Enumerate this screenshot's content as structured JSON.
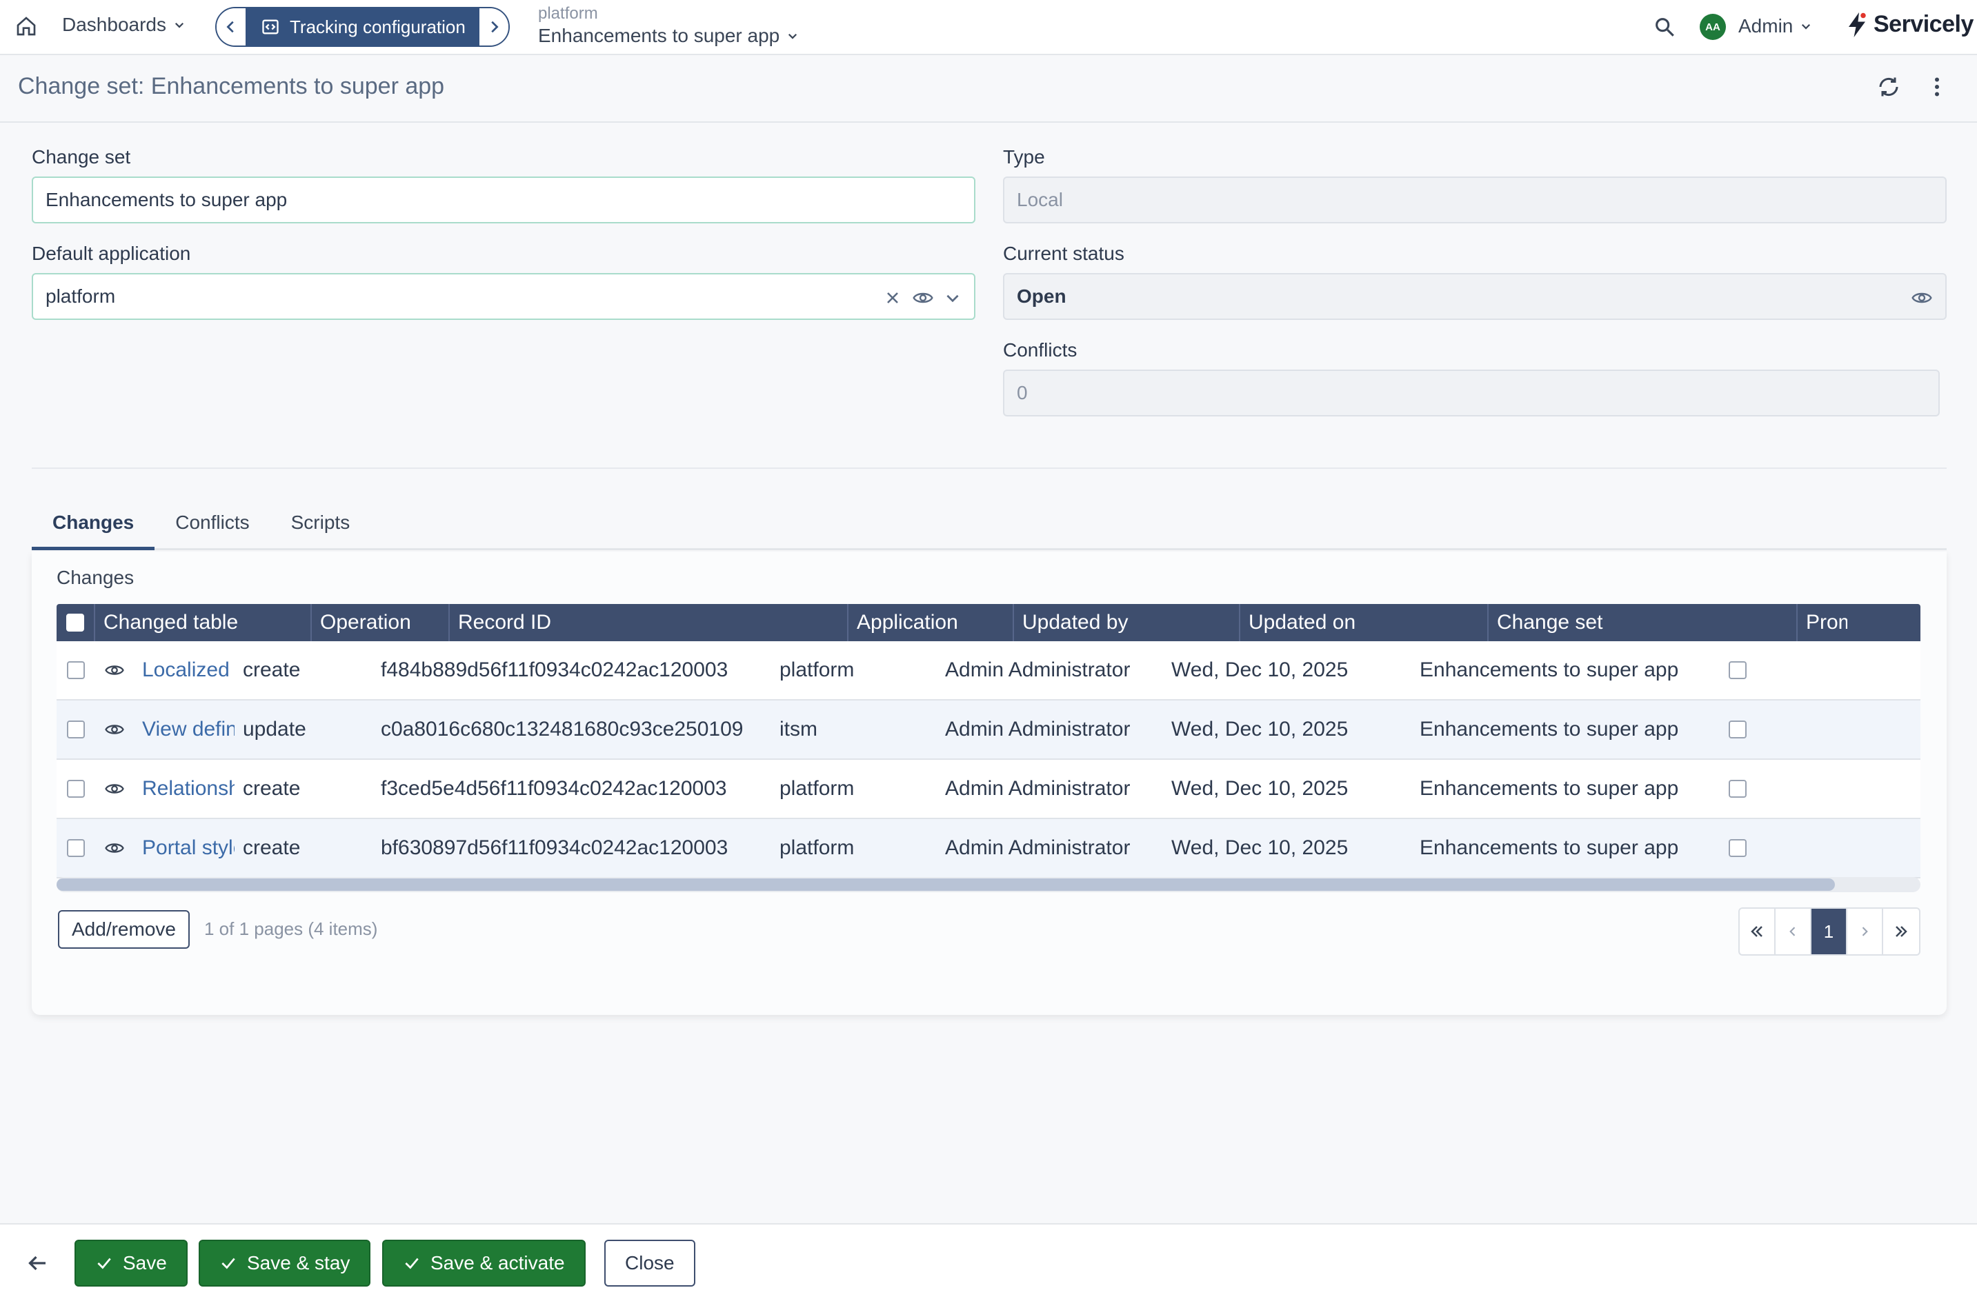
{
  "topbar": {
    "dashboards_label": "Dashboards",
    "tracking_label": "Tracking configuration",
    "context_scope": "platform",
    "context_changeset": "Enhancements to super app",
    "avatar_initials": "AA",
    "user_label": "Admin",
    "logo_text": "Servicely"
  },
  "page": {
    "title": "Change set: Enhancements to super app"
  },
  "form": {
    "change_set_label": "Change set",
    "change_set_value": "Enhancements to super app",
    "type_label": "Type",
    "type_value": "Local",
    "default_app_label": "Default application",
    "default_app_value": "platform",
    "status_label": "Current status",
    "status_value": "Open",
    "conflicts_label": "Conflicts",
    "conflicts_value": "0"
  },
  "tabs": [
    {
      "label": "Changes"
    },
    {
      "label": "Conflicts"
    },
    {
      "label": "Scripts"
    }
  ],
  "changes": {
    "title": "Changes",
    "columns": [
      "Changed table",
      "Operation",
      "Record ID",
      "Application",
      "Updated by",
      "Updated on",
      "Change set",
      "Prom"
    ],
    "rows": [
      {
        "table": "Localized message",
        "operation": "create",
        "record_id": "f484b889d56f11f0934c0242ac120003",
        "application": "platform",
        "updated_by": "Admin Administrator",
        "updated_on": "Wed, Dec 10, 2025",
        "change_set": "Enhancements to super app"
      },
      {
        "table": "View definition",
        "operation": "update",
        "record_id": "c0a8016c680c132481680c93ce250109",
        "application": "itsm",
        "updated_by": "Admin Administrator",
        "updated_on": "Wed, Dec 10, 2025",
        "change_set": "Enhancements to super app"
      },
      {
        "table": "Relationship definition",
        "operation": "create",
        "record_id": "f3ced5e4d56f11f0934c0242ac120003",
        "application": "platform",
        "updated_by": "Admin Administrator",
        "updated_on": "Wed, Dec 10, 2025",
        "change_set": "Enhancements to super app"
      },
      {
        "table": "Portal style",
        "operation": "create",
        "record_id": "bf630897d56f11f0934c0242ac120003",
        "application": "platform",
        "updated_by": "Admin Administrator",
        "updated_on": "Wed, Dec 10, 2025",
        "change_set": "Enhancements to super app"
      }
    ],
    "add_remove_label": "Add/remove",
    "page_info": "1 of 1 pages (4 items)",
    "current_page": "1"
  },
  "footer": {
    "save_label": "Save",
    "save_stay_label": "Save & stay",
    "save_activate_label": "Save & activate",
    "close_label": "Close"
  },
  "colors": {
    "primary_navy": "#34527f",
    "table_header": "#3e4e6e",
    "save_green": "#1f7a34",
    "link_blue": "#3b6aa8",
    "avatar_green": "#1f7a3a"
  }
}
